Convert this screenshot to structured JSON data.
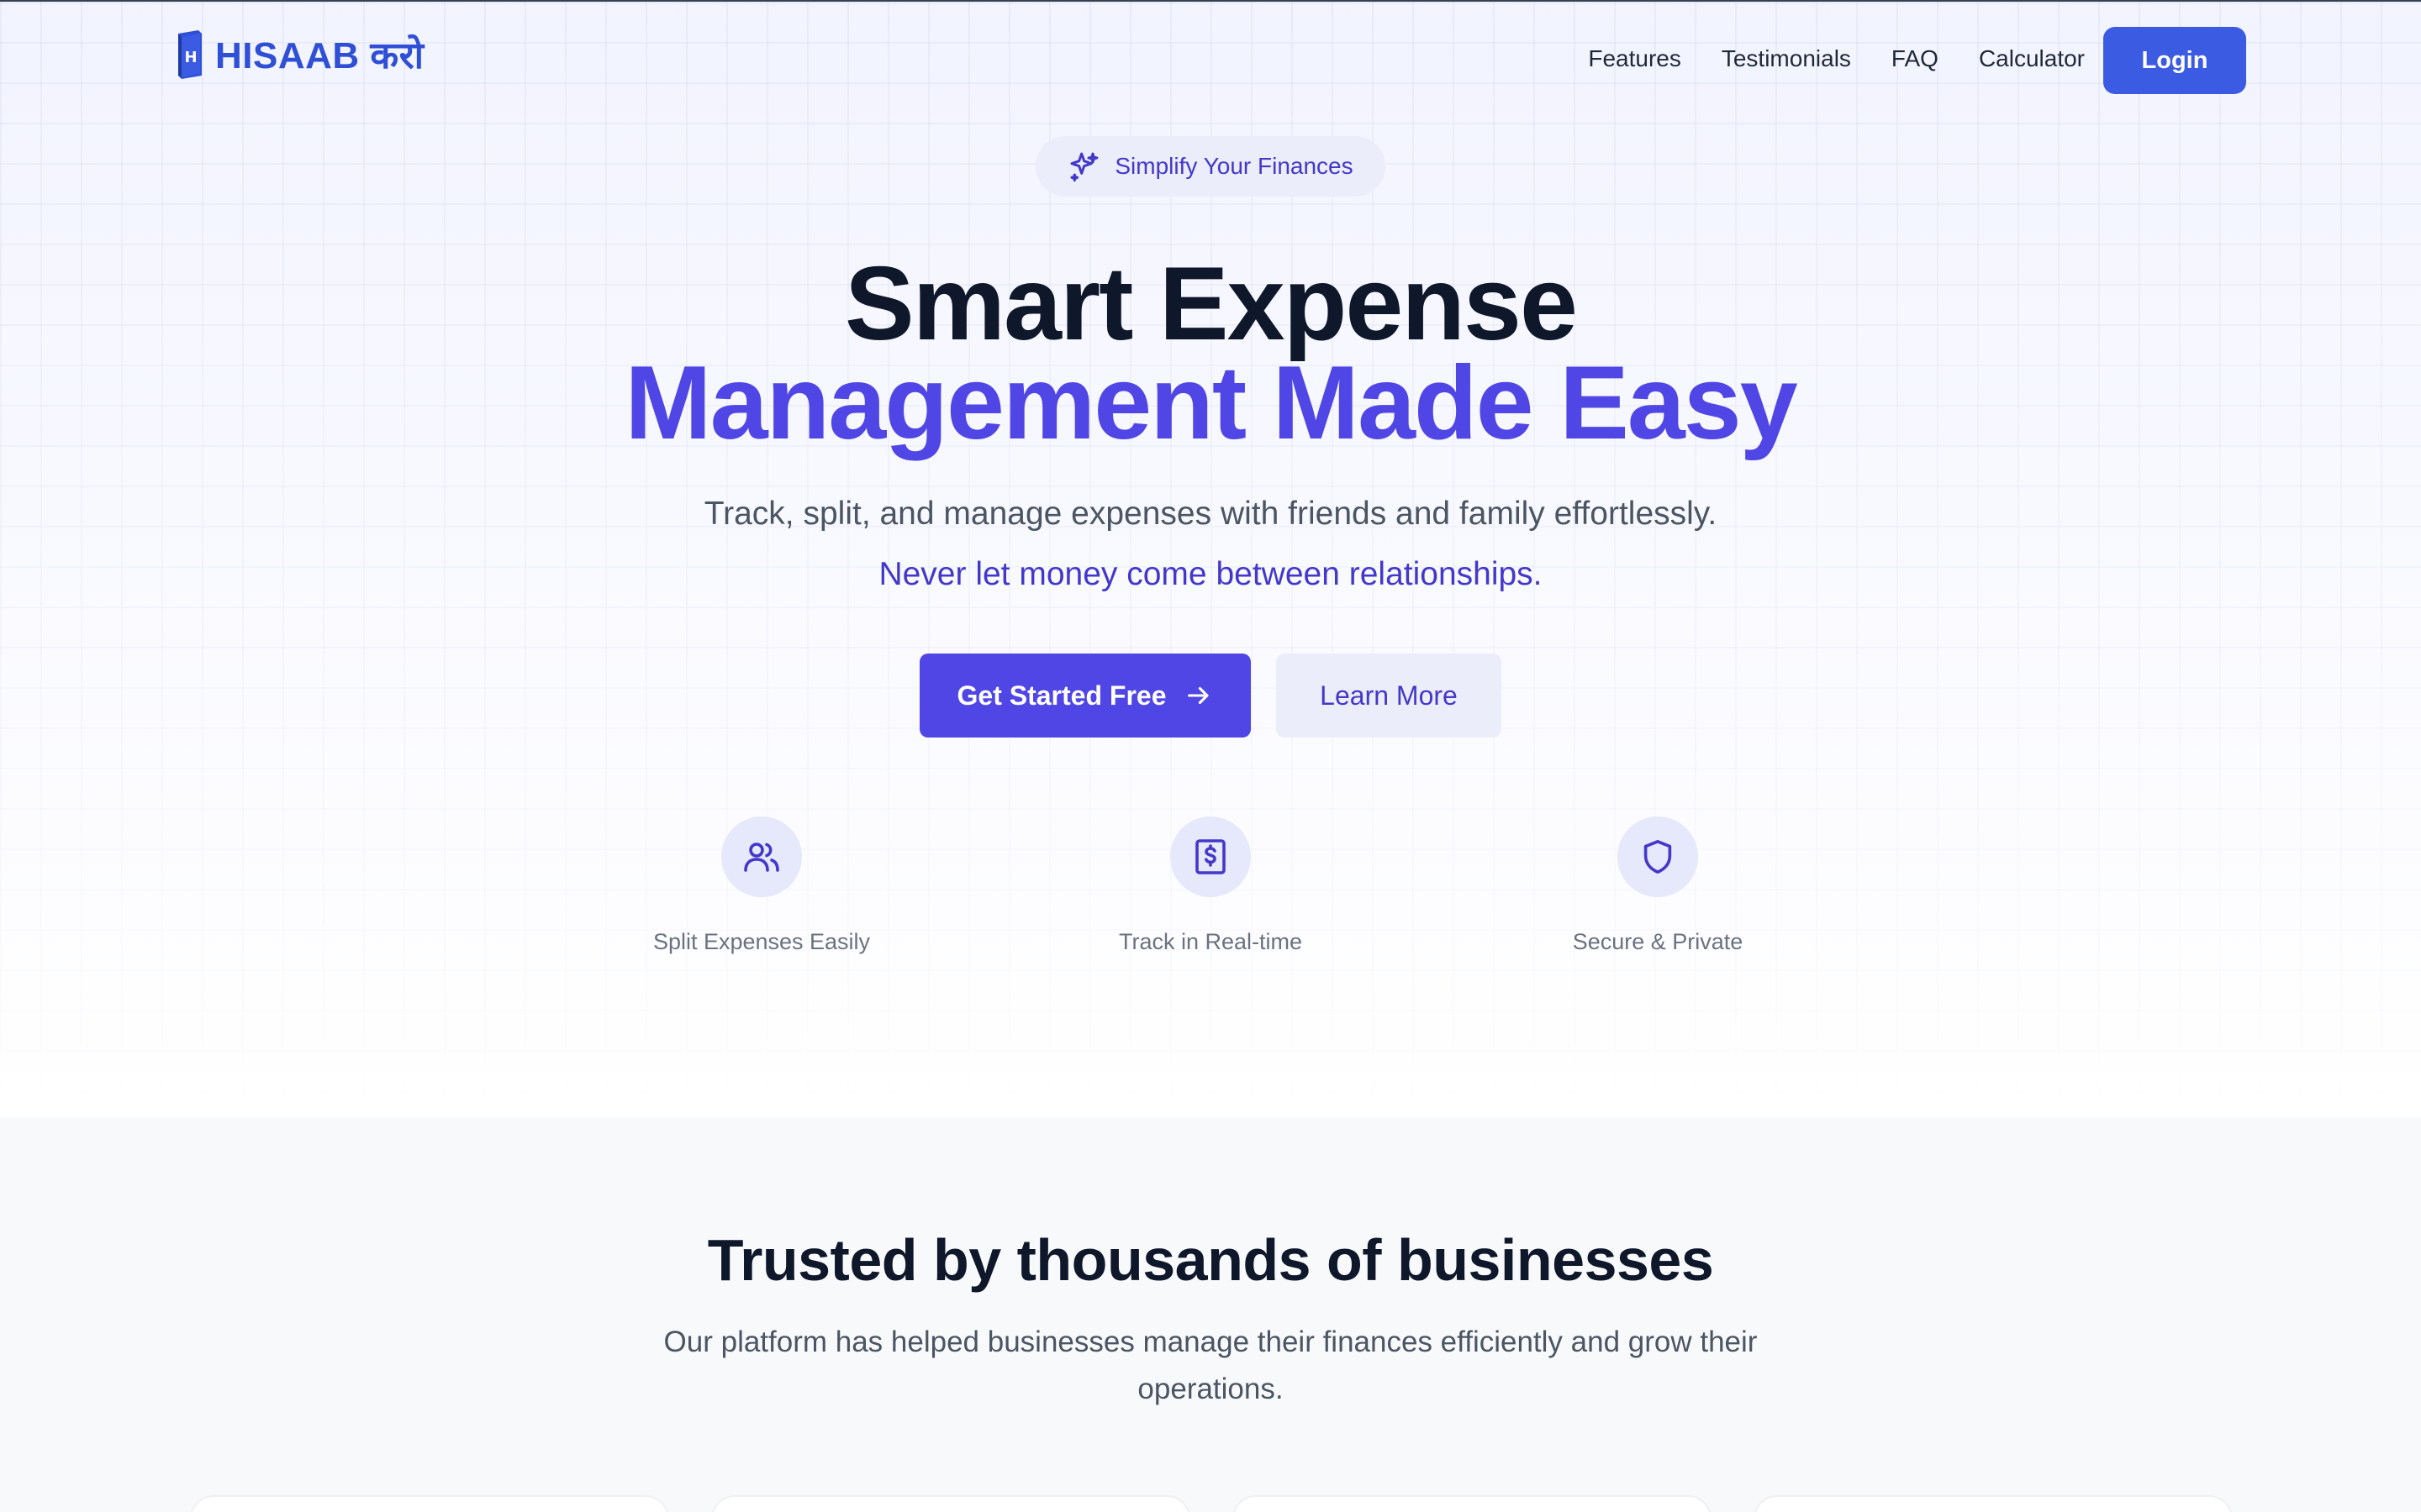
{
  "brand": {
    "name": "HISAAB करो",
    "color": "#2f4fd6"
  },
  "nav": {
    "links": [
      "Features",
      "Testimonials",
      "FAQ",
      "Calculator"
    ],
    "login_label": "Login"
  },
  "hero": {
    "badge": "Simplify Your Finances",
    "title_line1": "Smart Expense",
    "title_line2": "Management Made Easy",
    "subtitle": "Track, split, and manage expenses with friends and family effortlessly.",
    "tagline": "Never let money come between relationships.",
    "primary_cta": "Get Started Free",
    "secondary_cta": "Learn More",
    "features": [
      {
        "icon": "users-icon",
        "label": "Split Expenses Easily"
      },
      {
        "icon": "receipt-dollar-icon",
        "label": "Track in Real-time"
      },
      {
        "icon": "shield-icon",
        "label": "Secure & Private"
      }
    ]
  },
  "trusted": {
    "heading": "Trusted by thousands of businesses",
    "description": "Our platform has helped businesses manage their finances efficiently and grow their operations."
  },
  "colors": {
    "accent": "#4f46e5",
    "login": "#3b5be3",
    "accent_soft": "#ecedfb"
  }
}
